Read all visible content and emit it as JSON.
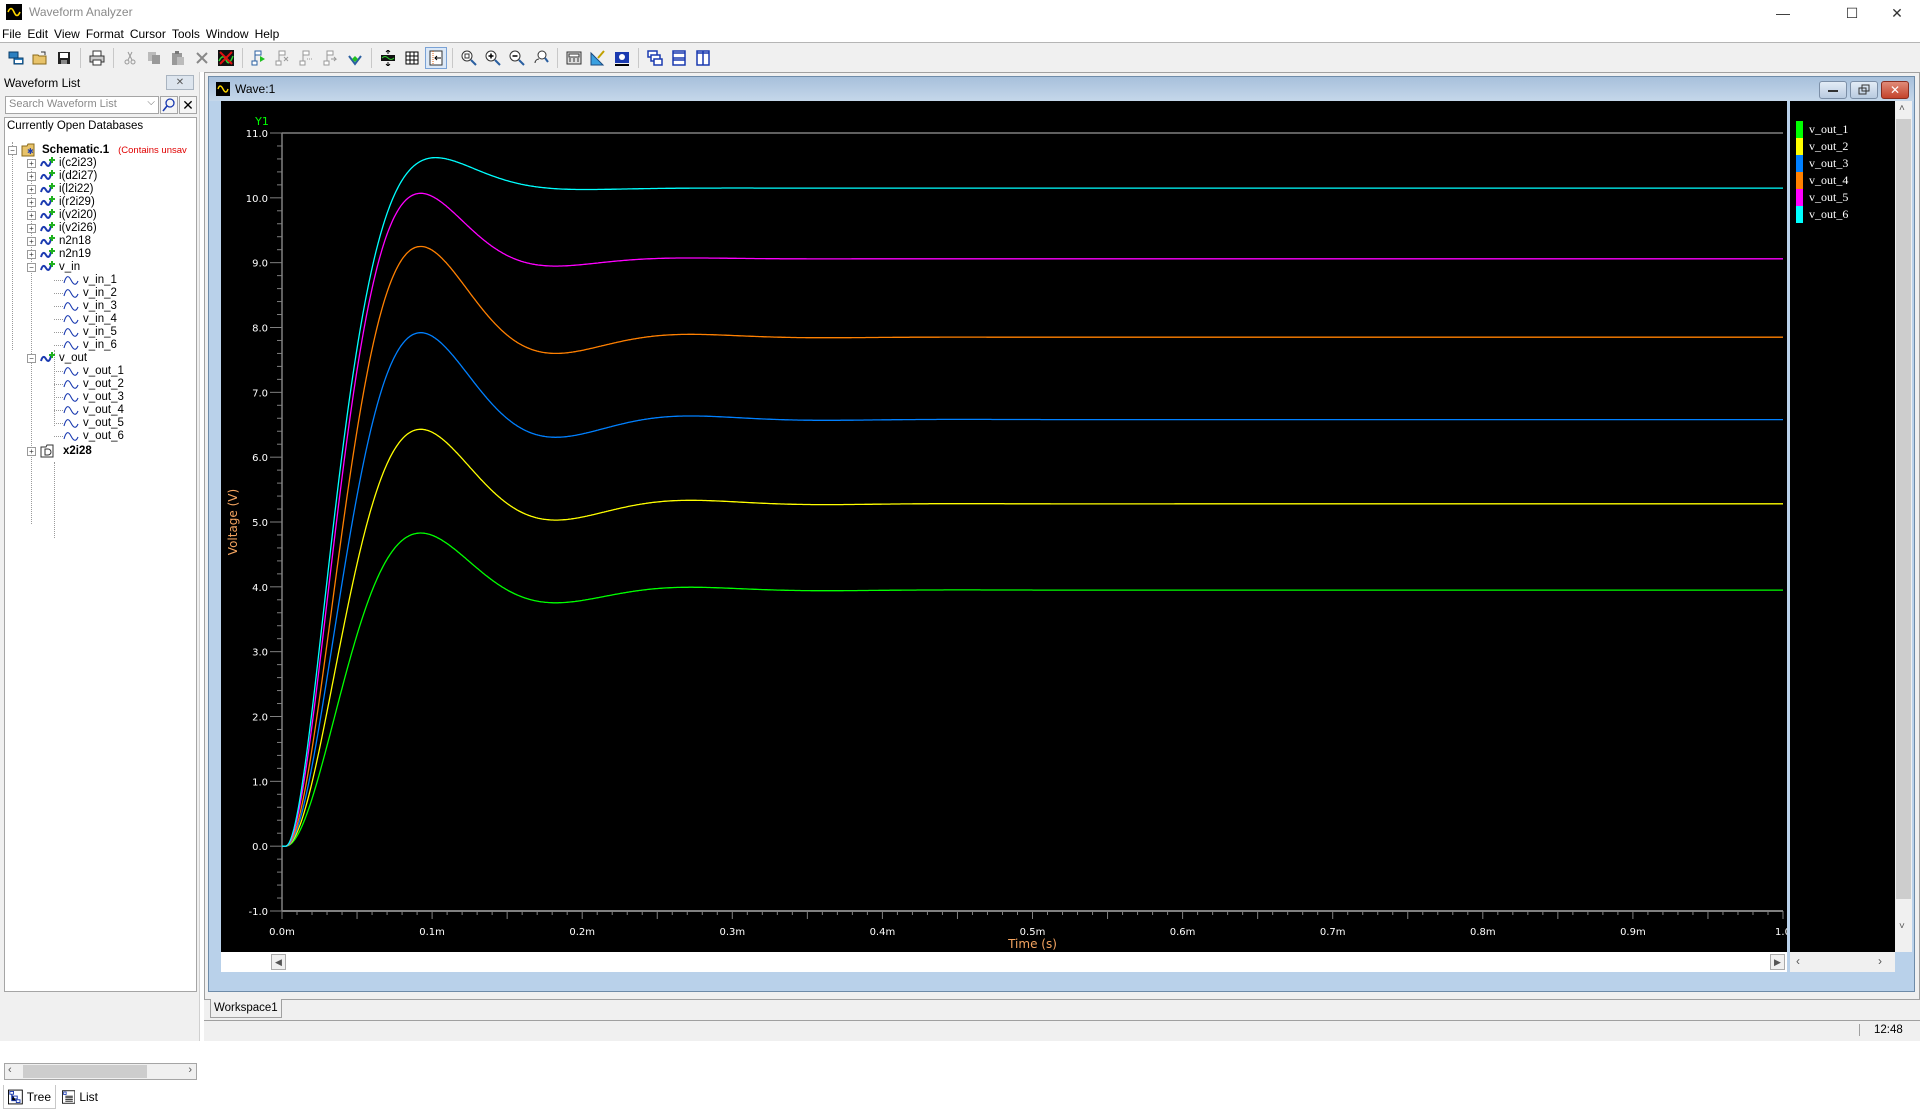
{
  "app": {
    "title": "Waveform Analyzer",
    "window_controls": {
      "minimize": "—",
      "maximize": "☐",
      "close": "✕"
    }
  },
  "menu": [
    "File",
    "Edit",
    "View",
    "Format",
    "Cursor",
    "Tools",
    "Window",
    "Help"
  ],
  "toolbar": {
    "groups": [
      [
        "new-window-icon",
        "open-folder-icon",
        "save-icon"
      ],
      [
        "print-icon"
      ],
      [
        "cut-icon",
        "copy-icon",
        "paste-icon",
        "delete-icon",
        "clear-waveforms-icon"
      ],
      [
        "add-waveform-icon",
        "remove-waveform-icon",
        "move-waveform-left-icon",
        "move-waveform-right-icon",
        "axis-waveform-icon"
      ],
      [
        "fit-vertical-icon",
        "grid-icon",
        "cursor-toggle-icon"
      ],
      [
        "zoom-fit-icon",
        "zoom-in-icon",
        "zoom-out-icon",
        "zoom-undo-icon"
      ],
      [
        "calculator-icon",
        "measure-icon",
        "chart-settings-icon"
      ],
      [
        "cascade-windows-icon",
        "tile-horizontal-icon",
        "tile-vertical-icon"
      ]
    ]
  },
  "waveform_list": {
    "header": "Waveform List",
    "close_label": "✕",
    "search_placeholder": "Search Waveform List",
    "tree_header": "Currently Open Databases",
    "database": {
      "name": "Schematic.1",
      "note": "(Contains unsav"
    },
    "signals": [
      "i(c2i23)",
      "i(d2i27)",
      "i(l2i22)",
      "i(r2i29)",
      "i(v2i20)",
      "i(v2i26)",
      "n2n18",
      "n2n19"
    ],
    "groups": [
      {
        "name": "v_in",
        "children": [
          "v_in_1",
          "v_in_2",
          "v_in_3",
          "v_in_4",
          "v_in_5",
          "v_in_6"
        ]
      },
      {
        "name": "v_out",
        "children": [
          "v_out_1",
          "v_out_2",
          "v_out_3",
          "v_out_4",
          "v_out_5",
          "v_out_6"
        ]
      }
    ],
    "subcircuit": "x2i28",
    "tabs": {
      "tree": "Tree",
      "list": "List"
    }
  },
  "wave_window": {
    "title": "Wave:1",
    "y_axis_name": "Y1"
  },
  "workspace_tab": "Workspace1",
  "status": {
    "time": "12:48"
  },
  "colors": {
    "v_out_1": "#00ff00",
    "v_out_2": "#ffff00",
    "v_out_3": "#0080ff",
    "v_out_4": "#ff8000",
    "v_out_5": "#ff00ff",
    "v_out_6": "#00ffff",
    "axis_label": "#f4a460",
    "y_axis_name": "#00ff00"
  },
  "chart_data": {
    "type": "line",
    "title": "",
    "xlabel": "Time (s)",
    "ylabel": "Voltage (V)",
    "xlim": [
      0.0,
      1.0
    ],
    "x_unit": "ms",
    "ylim": [
      -1.0,
      11.0
    ],
    "x_ticks": [
      "0.0m",
      "0.1m",
      "0.2m",
      "0.3m",
      "0.4m",
      "0.5m",
      "0.6m",
      "0.7m",
      "0.8m",
      "0.9m",
      "1.0"
    ],
    "y_ticks": [
      "-1.0",
      "0.0",
      "1.0",
      "2.0",
      "3.0",
      "4.0",
      "5.0",
      "6.0",
      "7.0",
      "8.0",
      "9.0",
      "10.0",
      "11.0"
    ],
    "legend_position": "right",
    "grid": false,
    "series": [
      {
        "name": "v_out_1",
        "final": 3.95,
        "peak": 4.83,
        "peak_t": 0.09,
        "trough": 3.78,
        "trough_t": 0.18
      },
      {
        "name": "v_out_2",
        "final": 5.28,
        "peak": 6.43,
        "peak_t": 0.09,
        "trough": 5.05,
        "trough_t": 0.18
      },
      {
        "name": "v_out_3",
        "final": 6.58,
        "peak": 7.92,
        "peak_t": 0.09,
        "trough": 6.32,
        "trough_t": 0.18
      },
      {
        "name": "v_out_4",
        "final": 7.85,
        "peak": 9.25,
        "peak_t": 0.09,
        "trough": 7.58,
        "trough_t": 0.18
      },
      {
        "name": "v_out_5",
        "final": 9.06,
        "peak": 10.07,
        "peak_t": 0.09,
        "trough": 8.88,
        "trough_t": 0.18
      },
      {
        "name": "v_out_6",
        "final": 10.15,
        "peak": 10.62,
        "peak_t": 0.1,
        "trough": 10.08,
        "trough_t": 0.18
      }
    ]
  }
}
